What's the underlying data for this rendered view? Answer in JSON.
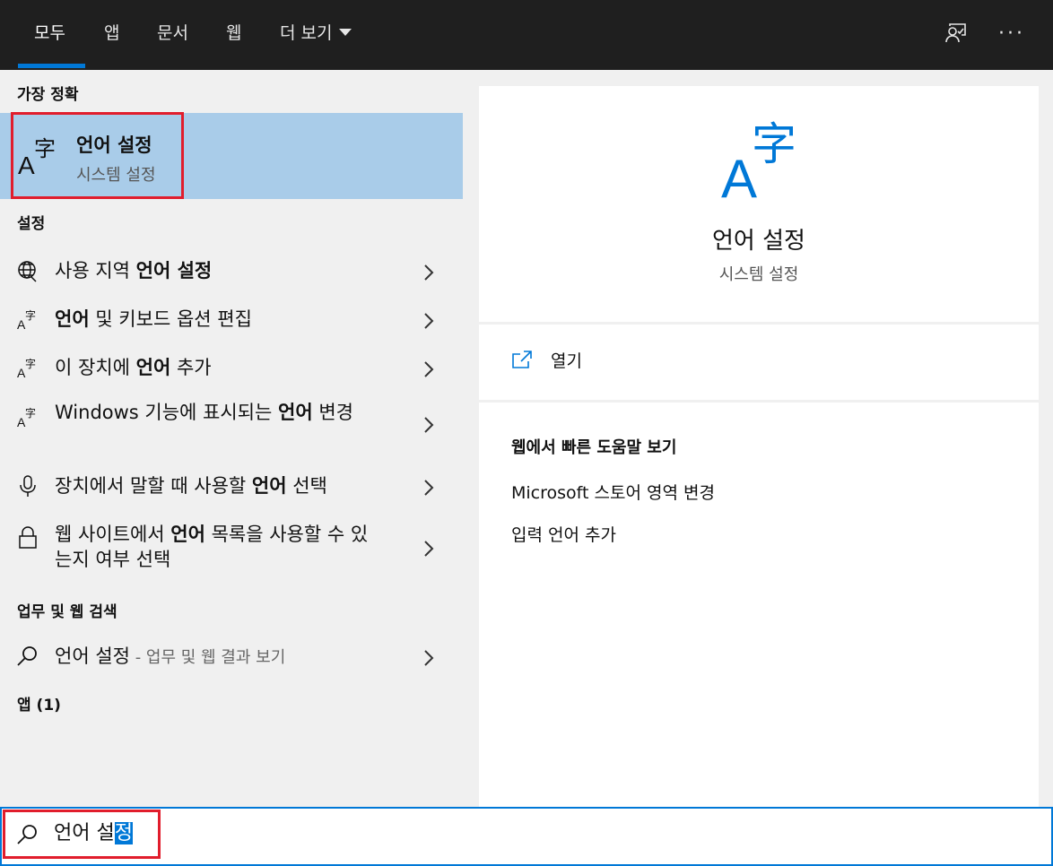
{
  "tabs": [
    {
      "label": "모두",
      "active": true
    },
    {
      "label": "앱"
    },
    {
      "label": "문서"
    },
    {
      "label": "웹"
    },
    {
      "label": "더 보기"
    }
  ],
  "top_icons": [
    "feedback-icon",
    "more-options-icon"
  ],
  "best_match": {
    "header": "가장 정확",
    "title": "언어 설정",
    "subtitle": "시스템 설정",
    "icon": "language-settings-icon"
  },
  "settings": {
    "header": "설정",
    "items": [
      {
        "icon": "globe-icon",
        "pre": "사용 지역 ",
        "bold": "언어 설정",
        "post": ""
      },
      {
        "icon": "language-icon",
        "pre": "",
        "bold": "언어",
        "post": " 및 키보드 옵션 편집"
      },
      {
        "icon": "language-icon",
        "pre": "이 장치에 ",
        "bold": "언어",
        "post": " 추가"
      },
      {
        "icon": "language-icon",
        "pre": "Windows 기능에 표시되는 ",
        "bold": "언어",
        "post": " 변경"
      },
      {
        "icon": "microphone-icon",
        "pre": "장치에서 말할 때 사용할 ",
        "bold": "언어",
        "post": " 선택"
      },
      {
        "icon": "lock-icon",
        "pre": "웹 사이트에서 ",
        "bold": "언어",
        "post": " 목록을 사용할 수 있는지 여부 선택"
      }
    ]
  },
  "web_search": {
    "header": "업무 및 웹 검색",
    "item": {
      "main": "언어 설정",
      "sub": " - 업무 및 웹 결과 보기"
    }
  },
  "apps": {
    "header": "앱 (1)"
  },
  "preview": {
    "title": "언어 설정",
    "subtitle": "시스템 설정",
    "open_label": "열기",
    "web_help_header": "웹에서 빠른 도움말 보기",
    "web_links": [
      "Microsoft 스토어 영역 변경",
      "입력 언어 추가"
    ]
  },
  "search": {
    "typed": "언어 설",
    "selected": "정"
  },
  "colors": {
    "accent": "#0078d7",
    "highlight": "#a9cce9",
    "annotation": "#e11d2c"
  }
}
